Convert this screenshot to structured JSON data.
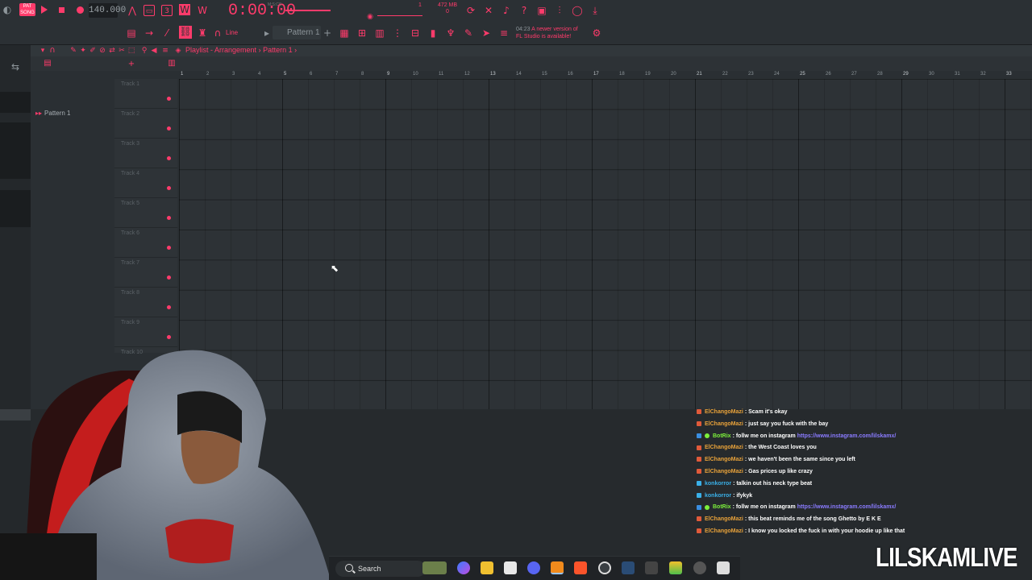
{
  "toolbar": {
    "song_badge": "PAT SONG",
    "tempo": "140.000",
    "time": "0:00:00",
    "time_unit": "M:S:CS",
    "cpu_count": "1",
    "memory": "472 MB",
    "memory_sub": "0",
    "snap": "Line",
    "pattern": "Pattern 1",
    "news_time": "04:23",
    "news_text": "A newer version of",
    "news_text2": "FL Studio is available!"
  },
  "playlist": {
    "breadcrumb": "Playlist - Arrangement",
    "pattern_crumb": "Pattern 1",
    "picker_items": [
      "Pattern 1"
    ],
    "tracks": [
      "Track 1",
      "Track 2",
      "Track 3",
      "Track 4",
      "Track 5",
      "Track 6",
      "Track 7",
      "Track 8",
      "Track 9",
      "Track 10"
    ],
    "bars": [
      "1",
      "2",
      "3",
      "4",
      "5",
      "6",
      "7",
      "8",
      "9",
      "10",
      "11",
      "12",
      "13",
      "14",
      "15",
      "16",
      "17",
      "18",
      "19",
      "20",
      "21",
      "22",
      "23",
      "24",
      "25",
      "26",
      "27",
      "28",
      "29",
      "30",
      "31",
      "32",
      "33"
    ]
  },
  "chat": [
    {
      "user": "ElChangoMazi",
      "user_color": "#e8a23a",
      "badge_color": "#e05a3a",
      "message": "Scam it's okay"
    },
    {
      "user": "ElChangoMazi",
      "user_color": "#e8a23a",
      "badge_color": "#e05a3a",
      "message": "just say you fuck with the bay"
    },
    {
      "user": "BotRix",
      "user_color": "#7cf03b",
      "badge_color": "#3a8ee0",
      "message": "follw me on instagram",
      "link": "https://www.instagram.com/lilskamx/"
    },
    {
      "user": "ElChangoMazi",
      "user_color": "#e8a23a",
      "badge_color": "#e05a3a",
      "message": "the West Coast loves you"
    },
    {
      "user": "ElChangoMazi",
      "user_color": "#e8a23a",
      "badge_color": "#e05a3a",
      "message": "we haven't been the same since you left"
    },
    {
      "user": "ElChangoMazi",
      "user_color": "#e8a23a",
      "badge_color": "#e05a3a",
      "message": "Gas prices up like crazy"
    },
    {
      "user": "konkorror",
      "user_color": "#3ab0e8",
      "badge_color": "#3ab0e8",
      "message": "talkin out his neck type beat"
    },
    {
      "user": "konkorror",
      "user_color": "#3ab0e8",
      "badge_color": "#3ab0e8",
      "message": "ifykyk"
    },
    {
      "user": "BotRix",
      "user_color": "#7cf03b",
      "badge_color": "#3a8ee0",
      "message": "follw me on instagram",
      "link": "https://www.instagram.com/lilskamx/"
    },
    {
      "user": "ElChangoMazi",
      "user_color": "#e8a23a",
      "badge_color": "#e05a3a",
      "message": "this beat reminds me of the song Ghetto by E K E"
    },
    {
      "user": "ElChangoMazi",
      "user_color": "#e8a23a",
      "badge_color": "#e05a3a",
      "message": "I know you locked the fuck in with your hoodie up like that"
    }
  ],
  "taskbar": {
    "search_label": "Search",
    "apps": [
      "widgets-icon",
      "copilot-icon",
      "file-explorer-icon",
      "store-icon",
      "discord-icon",
      "fl-studio-icon",
      "brave-icon",
      "obs-icon",
      "steam-icon",
      "app-icon",
      "bluestacks-icon",
      "app-icon-2",
      "app-icon-3"
    ]
  },
  "watermark": "LILSKAMLIVE",
  "colors": {
    "accent": "#ff3b6b",
    "background": "#23272a",
    "link": "#8a7bff"
  }
}
